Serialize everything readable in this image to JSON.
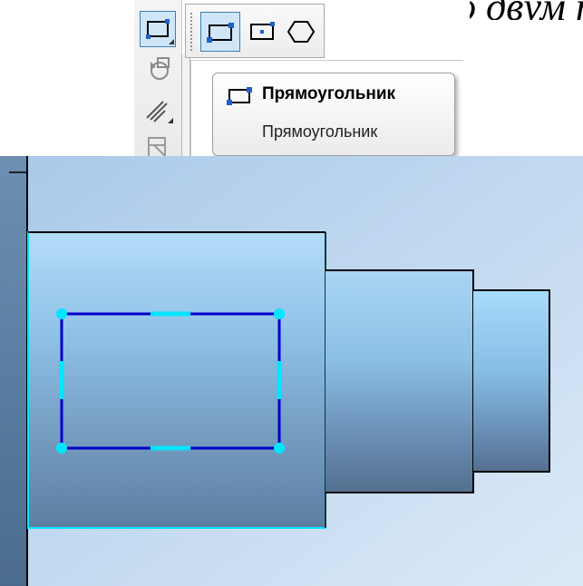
{
  "top_text": "…ямоугольник по двум точкам",
  "tooltip": {
    "title": "Прямоугольник",
    "description": "Прямоугольник"
  },
  "toolbar": {
    "vertical_tools": [
      {
        "icon": "rectangle-tool-icon",
        "active": true
      },
      {
        "icon": "rotate-icon",
        "active": false
      },
      {
        "icon": "hatch-icon",
        "active": false
      },
      {
        "icon": "fill-icon",
        "active": false
      }
    ],
    "flyout_tools": [
      {
        "icon": "rectangle-two-points-icon",
        "active": true
      },
      {
        "icon": "rectangle-center-vertex-icon",
        "active": false
      },
      {
        "icon": "polygon-icon",
        "active": false
      }
    ]
  },
  "colors": {
    "selected_outline": "#00e6ff",
    "rectangle_stroke": "#0000cc",
    "control_point": "#00e6ff",
    "part_edge": "#000000"
  }
}
